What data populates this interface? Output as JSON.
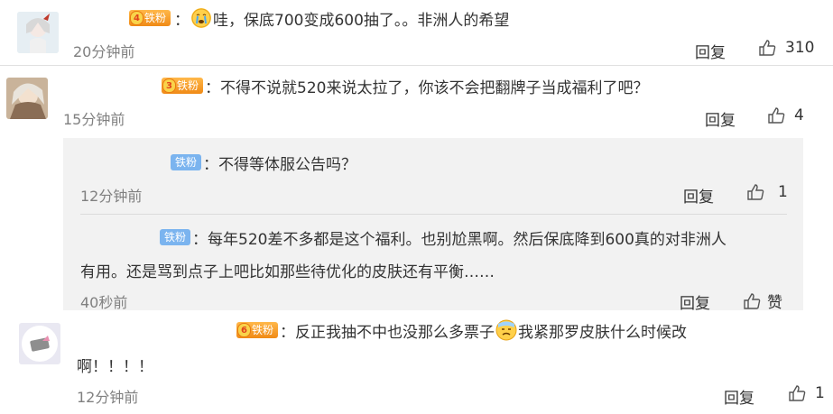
{
  "comments": [
    {
      "badge": "铁粉",
      "level": "4",
      "text_after_emoji": "哇，保底700变成600抽了。。非洲人的希望",
      "time": "20分钟前",
      "reply": "回复",
      "likes": "310"
    },
    {
      "badge": "铁粉",
      "level": "3",
      "text": "：不得不说就520来说太拉了，你该不会把翻牌子当成福利了吧？",
      "time": "15分钟前",
      "reply": "回复",
      "likes": "4"
    },
    {
      "badge": "铁粉",
      "level": "6",
      "text_before_emoji": "：反正我抽不中也没那么多票子",
      "text_after_emoji": "我紧那罗皮肤什么时候改",
      "text_line2": "啊！！！！",
      "time": "12分钟前",
      "reply": "回复",
      "likes": "1"
    }
  ],
  "replies": [
    {
      "badge": "铁粉",
      "text": "：不得等体服公告吗？",
      "time": "12分钟前",
      "reply": "回复",
      "likes": "1"
    },
    {
      "badge": "铁粉",
      "text_line1": "：每年520差不多都是这个福利。也别尬黑啊。然后保底降到600真的对非洲人",
      "text_line2": "有用。还是骂到点子上吧比如那些待优化的皮肤还有平衡……",
      "time": "40秒前",
      "reply": "回复",
      "likes": "赞"
    }
  ],
  "colon": "：",
  "icons": {
    "like": "thumbs-up-icon",
    "crying": "crying-face-emoji",
    "sweat": "sweat-face-emoji"
  }
}
